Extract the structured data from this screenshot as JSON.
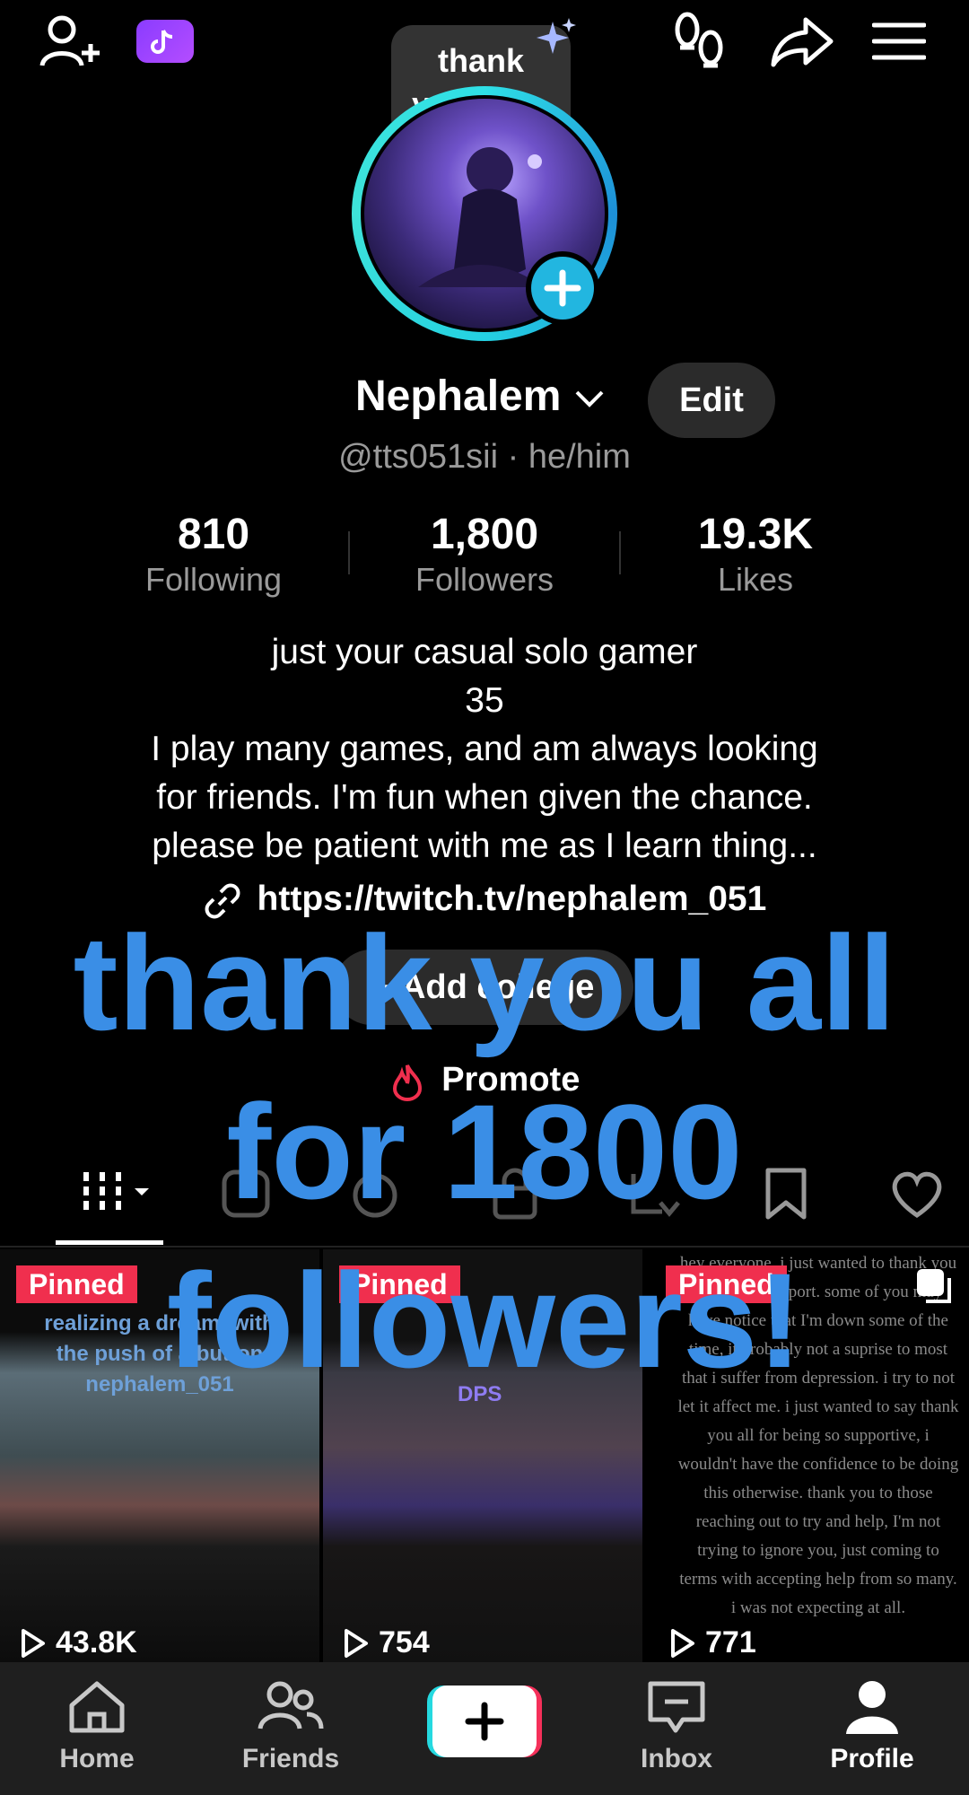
{
  "topbar": {
    "add_friend_icon": "person-plus-icon",
    "tiktok_badge_icon": "tiktok-note-icon",
    "footprints_icon": "footprints-icon",
    "share_icon": "share-arrow-icon",
    "menu_icon": "hamburger-menu-icon"
  },
  "note_bubble": {
    "text_line1": "thank",
    "text_line2": "you all ..."
  },
  "profile": {
    "display_name": "Nephalem",
    "edit_label": "Edit",
    "handle": "@tts051sii · he/him"
  },
  "stats": [
    {
      "value": "810",
      "label": "Following"
    },
    {
      "value": "1,800",
      "label": "Followers"
    },
    {
      "value": "19.3K",
      "label": "Likes"
    }
  ],
  "bio": {
    "line1": "just your casual solo gamer",
    "line2": "35",
    "line3": "I play many games, and am always looking",
    "line4": "for friends. I'm fun when given the chance.",
    "line5": "please be patient with me as I learn thing..."
  },
  "link": {
    "url": "https://twitch.tv/nephalem_051"
  },
  "college_button": {
    "label": "+ Add college"
  },
  "promote": {
    "label": "Promote"
  },
  "overlay_text": {
    "line1": "thank you all",
    "line2": "for 1800",
    "line3": "followers!"
  },
  "tabs": [
    "videos-grid",
    "repost",
    "favorites-effects",
    "private-lock",
    "reposts",
    "bookmarks",
    "liked"
  ],
  "videos": [
    {
      "badge": "Pinned",
      "caption1": "realizing a dream, with",
      "caption2": "the push of a button",
      "caption3": "nephalem_051",
      "views": "43.8K"
    },
    {
      "badge": "Pinned",
      "caption1": "DPS",
      "views": "754"
    },
    {
      "badge": "Pinned",
      "text": "hey everyone, i just wanted to thank you all for the support. some of you may have notice that I'm down some of the time, it probably not a suprise to most that i suffer from depression. i try to not let it affect me. i just wanted to say thank you all for being so supportive, i wouldn't have the confidence to be doing this otherwise. thank you to those reaching out to try and help, I'm not trying to ignore you, just coming to terms with accepting help from so many. i was not expecting at all.",
      "views": "771"
    }
  ],
  "nav": {
    "home": "Home",
    "friends": "Friends",
    "inbox": "Inbox",
    "profile": "Profile"
  },
  "colors": {
    "accent": "#22b6e0",
    "overlay_text": "#3a8ee6",
    "pinned": "#f02f4e"
  }
}
